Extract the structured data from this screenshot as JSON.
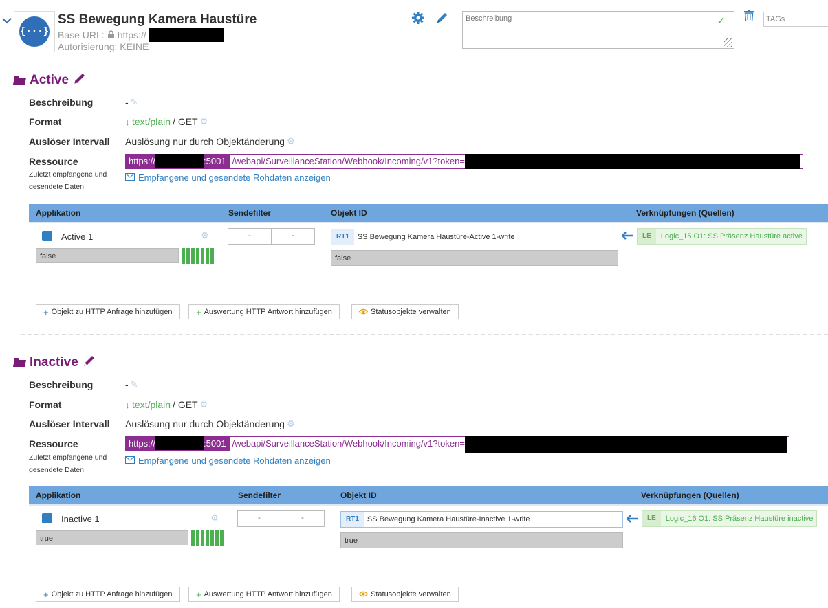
{
  "header": {
    "title": "SS Bewegung Kamera Haustüre",
    "base_url_label": "Base URL:",
    "base_url_value": "https://",
    "auth_label": "Autorisierung: KEINE",
    "logo_text": "{···}",
    "description_placeholder": "Beschreibung",
    "tags_placeholder": "TAGs"
  },
  "icons": {
    "collapse": "chevron-down",
    "settings": "gear",
    "edit": "pencil",
    "trash": "trash",
    "lock": "lock",
    "folder": "folder-open",
    "envelope": "envelope",
    "arrow_down": "arrow-down",
    "arrow_left": "arrow-left",
    "eye": "eye"
  },
  "colors": {
    "section_title": "#7a1b78",
    "resource_bg": "#8b2d91",
    "table_header": "#6ea6dd",
    "accent": "#2f7fc1",
    "ok": "#4caf50"
  },
  "sections": [
    {
      "title": "Active",
      "labels": {
        "beschreibung": "Beschreibung",
        "format": "Format",
        "interval": "Auslöser Intervall",
        "resource": "Ressource",
        "received": "Zuletzt empfangene und gesendete Daten"
      },
      "beschreibung_value": "-",
      "format_type": "text/plain",
      "format_method": "/ GET",
      "interval_value": "Auslösung nur durch Objektänderung",
      "resource_proto": "https://",
      "resource_port": ":5001",
      "resource_path": "/webapi/SurveillanceStation/Webhook/Incoming/v1?token=",
      "raw_link": "Empfangene und gesendete Rohdaten anzeigen",
      "table_headers": {
        "app": "Applikation",
        "filter": "Sendefilter",
        "obj": "Objekt ID",
        "links": "Verknüpfungen (Quellen)"
      },
      "row": {
        "app_name": "Active 1",
        "app_value": "false",
        "filter_a": "-",
        "filter_b": "-",
        "obj_tag": "RT1",
        "obj_name": "SS Bewegung Kamera Haustüre-Active 1-write",
        "obj_value": "false",
        "link_tag": "LE",
        "link_name": "Logic_15 O1: SS Präsenz Haustüre active"
      },
      "buttons": {
        "add_request": "Objekt zu HTTP Anfrage hinzufügen",
        "add_response": "Auswertung HTTP Antwort hinzufügen",
        "status": "Statusobjekte verwalten"
      }
    },
    {
      "title": "Inactive",
      "labels": {
        "beschreibung": "Beschreibung",
        "format": "Format",
        "interval": "Auslöser Intervall",
        "resource": "Ressource",
        "received": "Zuletzt empfangene und gesendete Daten"
      },
      "beschreibung_value": "-",
      "format_type": "text/plain",
      "format_method": "/ GET",
      "interval_value": "Auslösung nur durch Objektänderung",
      "resource_proto": "https://",
      "resource_port": ":5001",
      "resource_path": "/webapi/SurveillanceStation/Webhook/Incoming/v1?token=",
      "raw_link": "Empfangene und gesendete Rohdaten anzeigen",
      "table_headers": {
        "app": "Applikation",
        "filter": "Sendefilter",
        "obj": "Objekt ID",
        "links": "Verknüpfungen (Quellen)"
      },
      "row": {
        "app_name": "Inactive 1",
        "app_value": "true",
        "filter_a": "-",
        "filter_b": "-",
        "obj_tag": "RT1",
        "obj_name": "SS Bewegung Kamera Haustüre-Inactive 1-write",
        "obj_value": "true",
        "link_tag": "LE",
        "link_name": "Logic_16 O1: SS Präsenz Haustüre inactive"
      },
      "buttons": {
        "add_request": "Objekt zu HTTP Anfrage hinzufügen",
        "add_response": "Auswertung HTTP Antwort hinzufügen",
        "status": "Statusobjekte verwalten"
      }
    }
  ]
}
